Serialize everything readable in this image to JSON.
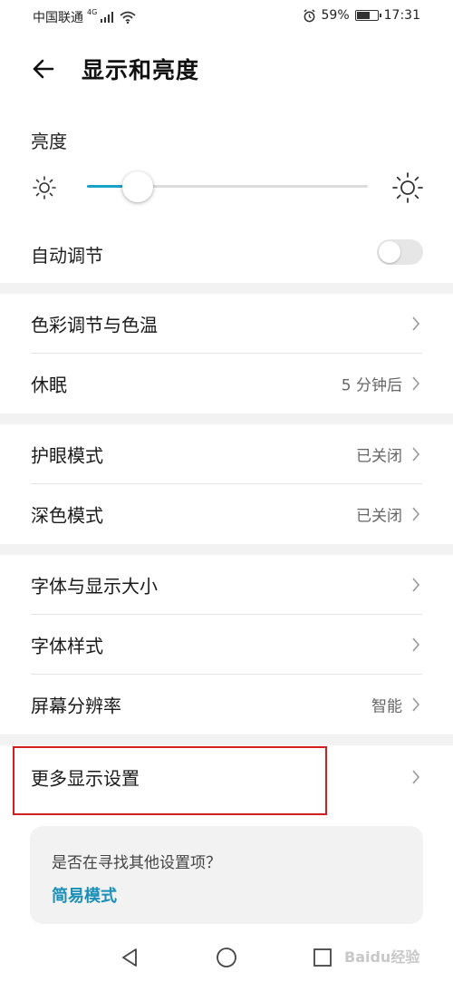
{
  "status_bar": {
    "carrier": "中国联通",
    "network": "4G",
    "alarm_icon": "alarm-clock-icon",
    "battery_percent": "59%",
    "battery_level": 0.59,
    "time": "17:31"
  },
  "header": {
    "title": "显示和亮度",
    "back_icon": "arrow-left-icon"
  },
  "brightness": {
    "label": "亮度",
    "level": 0.18,
    "accent": "#1aa3c9"
  },
  "auto_adjust": {
    "label": "自动调节",
    "enabled": false
  },
  "settings": {
    "color_temp": {
      "label": "色彩调节与色温"
    },
    "sleep": {
      "label": "休眠",
      "value": "5 分钟后"
    },
    "eye_comfort": {
      "label": "护眼模式",
      "value": "已关闭"
    },
    "dark_mode": {
      "label": "深色模式",
      "value": "已关闭"
    },
    "font_display_size": {
      "label": "字体与显示大小"
    },
    "font_style": {
      "label": "字体样式"
    },
    "resolution": {
      "label": "屏幕分辨率",
      "value": "智能"
    },
    "more_display": {
      "label": "更多显示设置"
    }
  },
  "tip": {
    "question": "是否在寻找其他设置项？",
    "link": "简易模式",
    "link_color": "#1a8fb8"
  },
  "annotation": {
    "highlight_color": "#d21f1f"
  },
  "nav_bar": {
    "back_icon": "triangle-back-icon",
    "home_icon": "circle-home-icon",
    "recent_icon": "square-recent-icon",
    "watermark": "Baidu经验"
  }
}
